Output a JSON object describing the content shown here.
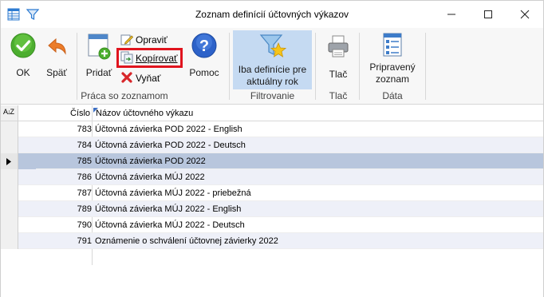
{
  "window": {
    "title": "Zoznam definícií účtovných výkazov"
  },
  "ribbon": {
    "ok_label": "OK",
    "back_label": "Späť",
    "add_label": "Pridať",
    "edit_label": "Opraviť",
    "copy_label": "Kopírovať",
    "delete_label": "Vyňať",
    "help_label": "Pomoc",
    "filter_label": "Iba definície pre aktuálny rok",
    "print_label": "Tlač",
    "prepared_label": "Pripravený zoznam",
    "groups": {
      "list_work": "Práca so zoznamom",
      "filtering": "Filtrovanie",
      "print": "Tlač",
      "data": "Dáta"
    }
  },
  "grid": {
    "columns": {
      "sort": "A↓Z",
      "number": "Číslo",
      "name": "Názov účtovného výkazu"
    },
    "rows": [
      {
        "number": "783",
        "name": "Účtovná závierka POD 2022 - English"
      },
      {
        "number": "784",
        "name": "Účtovná závierka POD 2022 - Deutsch"
      },
      {
        "number": "785",
        "name": "Účtovná závierka POD 2022"
      },
      {
        "number": "786",
        "name": "Účtovná závierka MÚJ 2022"
      },
      {
        "number": "787",
        "name": "Účtovná závierka MÚJ 2022 - priebežná"
      },
      {
        "number": "789",
        "name": "Účtovná závierka MÚJ 2022 - English"
      },
      {
        "number": "790",
        "name": "Účtovná závierka MÚJ 2022 - Deutsch"
      },
      {
        "number": "791",
        "name": "Oznámenie o schválení účtovnej závierky 2022"
      }
    ],
    "selected_row": 2
  },
  "colors": {
    "selection": "#b8c6dd",
    "filter_active": "#c5daf2",
    "highlight": "#e0141e"
  }
}
